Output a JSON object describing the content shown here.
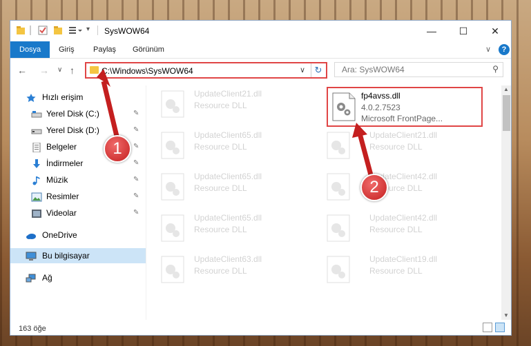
{
  "window": {
    "title": "SysWOW64",
    "minimize_glyph": "—",
    "maximize_glyph": "☐",
    "close_glyph": "✕"
  },
  "ribbon": {
    "tabs": [
      "Dosya",
      "Giriş",
      "Paylaş",
      "Görünüm"
    ],
    "collapse_glyph": "∨",
    "help_glyph": "?"
  },
  "nav": {
    "back_glyph": "←",
    "forward_glyph": "→",
    "recent_glyph": "∨",
    "up_glyph": "↑",
    "address_path": "C:\\Windows\\SysWOW64",
    "address_dropdown_glyph": "∨",
    "refresh_glyph": "↻",
    "search_placeholder": "Ara: SysWOW64",
    "search_glyph": "⚲"
  },
  "sidebar": {
    "quick_access": "Hızlı erişim",
    "items": [
      {
        "label": "Yerel Disk (C:)",
        "icon": "drive-icon"
      },
      {
        "label": "Yerel Disk (D:)",
        "icon": "drive-icon"
      },
      {
        "label": "Belgeler",
        "icon": "documents-icon"
      },
      {
        "label": "İndirmeler",
        "icon": "downloads-icon"
      },
      {
        "label": "Müzik",
        "icon": "music-icon"
      },
      {
        "label": "Resimler",
        "icon": "pictures-icon"
      },
      {
        "label": "Videolar",
        "icon": "videos-icon"
      }
    ],
    "onedrive": "OneDrive",
    "this_pc": "Bu bilgisayar",
    "network": "Ağ",
    "pin_glyph": "📌"
  },
  "files": {
    "left_column": [
      {
        "name": "UpdateClient21.dll",
        "type": "Resource DLL"
      },
      {
        "name": "UpdateClient65.dll",
        "type": "Resource DLL"
      },
      {
        "name": "UpdateClient65.dll",
        "type": "Resource DLL"
      },
      {
        "name": "UpdateClient65.dll",
        "type": "Resource DLL"
      },
      {
        "name": "UpdateClient63.dll",
        "type": "Resource DLL"
      }
    ],
    "right_column": [
      {
        "name": "UpdateClient21.dll",
        "type": "Resource DLL"
      },
      {
        "name": "UpdateClient42.dll",
        "type": "Resource DLL"
      },
      {
        "name": "UpdateClient42.dll",
        "type": "Resource DLL"
      },
      {
        "name": "UpdateClient19.dll",
        "type": "Resource DLL"
      }
    ],
    "highlighted": {
      "name": "fp4avss.dll",
      "version": "4.0.2.7523",
      "description": "Microsoft FrontPage..."
    }
  },
  "status": {
    "item_count": "163 öğe"
  },
  "annotations": {
    "step1": "1",
    "step2": "2"
  },
  "colors": {
    "accent": "#1979ca",
    "highlight_border": "#e04545",
    "selected_nav": "#cce4f7"
  }
}
